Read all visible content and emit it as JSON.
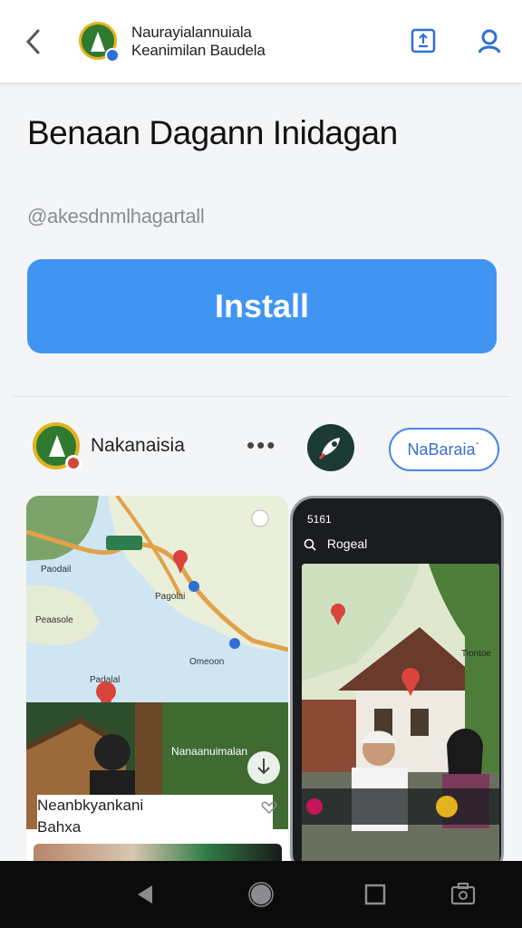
{
  "header": {
    "title_line1": "Naurayialannuiala",
    "title_line2": "Keanimilan Baudela"
  },
  "app": {
    "title": "Benaan Dagann Inidagan",
    "handle": "@akesdnmlhagartall",
    "install_label": "Install"
  },
  "developer": {
    "name": "Nakanaisia",
    "more_label": "•••",
    "pill_label": "NaBaraia˙"
  },
  "screenshot_left": {
    "map_labels": [
      "Paodail",
      "Pagolai",
      "Peaasole",
      "Omeoon",
      "Padalal"
    ],
    "photo_label": "Nanaanuimalan",
    "caption_line1": "Neanbkyankani",
    "caption_line2": "Bahxa"
  },
  "screenshot_phone": {
    "time": "5161",
    "search_text": "Rogeal",
    "map_label": "Tiontoe"
  },
  "colors": {
    "accent": "#4095f2",
    "outline": "#4b86e2",
    "brand_green": "#2f7a2f",
    "brand_gold": "#e3b21f"
  }
}
